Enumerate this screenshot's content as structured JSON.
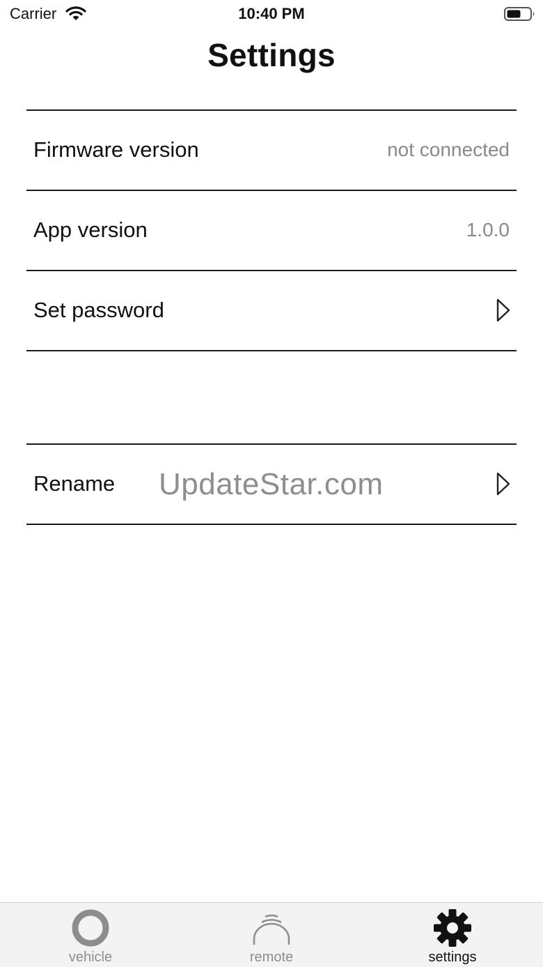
{
  "status_bar": {
    "carrier": "Carrier",
    "time": "10:40 PM",
    "icons": [
      "wifi-icon",
      "battery-icon"
    ]
  },
  "header": {
    "title": "Settings"
  },
  "settings": {
    "firmware": {
      "label": "Firmware version",
      "value": "not connected"
    },
    "app_version": {
      "label": "App version",
      "value": "1.0.0"
    },
    "set_password": {
      "label": "Set password",
      "icon": "chevron-right-icon"
    },
    "rename": {
      "label": "Rename",
      "icon": "chevron-right-icon"
    }
  },
  "watermark": "UpdateStar.com",
  "tab_bar": {
    "tabs": [
      {
        "label": "vehicle",
        "icon": "ring-icon",
        "active": false
      },
      {
        "label": "remote",
        "icon": "signal-arc-icon",
        "active": false
      },
      {
        "label": "settings",
        "icon": "gear-icon",
        "active": true
      }
    ]
  },
  "colors": {
    "text": "#111111",
    "secondary_text": "#8a8a8a",
    "divider": "#1a1a1a",
    "tab_bar_bg": "#f3f3f3",
    "inactive_icon": "#8d8d8d"
  }
}
